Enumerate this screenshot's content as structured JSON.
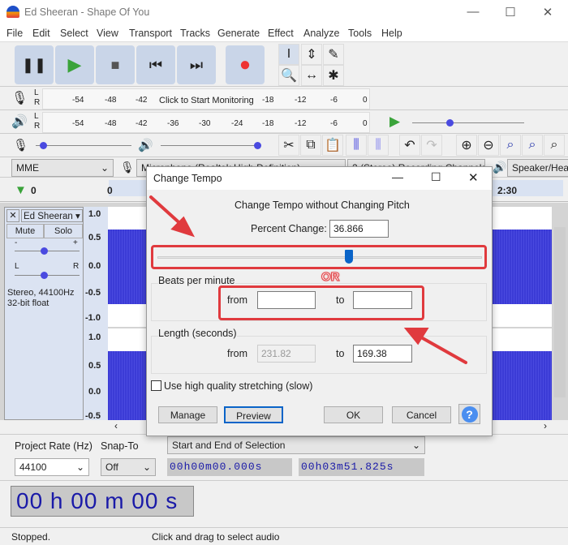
{
  "window": {
    "title": "Ed Sheeran - Shape Of You",
    "minimize": "—",
    "maximize": "☐",
    "close": "✕"
  },
  "menu": [
    "File",
    "Edit",
    "Select",
    "View",
    "Transport",
    "Tracks",
    "Generate",
    "Effect",
    "Analyze",
    "Tools",
    "Help"
  ],
  "transport": {
    "pause": "❚❚",
    "play": "▶",
    "stop": "■",
    "skip_start": "⏮",
    "skip_end": "⏭",
    "record": "●"
  },
  "tools": [
    "I",
    "⇕",
    "✎",
    "🔍",
    "↔",
    "✱"
  ],
  "record_meter": {
    "ticks": [
      "-54",
      "-48",
      "-42",
      "-18",
      "-12",
      "-6",
      "0"
    ],
    "prompt": "Click to Start Monitoring"
  },
  "play_meter": {
    "ticks": [
      "-54",
      "-48",
      "-42",
      "-36",
      "-30",
      "-24",
      "-18",
      "-12",
      "-6",
      "0"
    ]
  },
  "lr": [
    "L",
    "R"
  ],
  "slider_minus": "-",
  "slider_plus": "+",
  "devices": {
    "host": "MME",
    "mic": "Microphone (Realtek High Definition)",
    "channels": "2 (Stereo) Recording Channels",
    "speaker": "Speaker/Hea"
  },
  "timeline": {
    "labels": [
      "0",
      "0",
      "2:30"
    ]
  },
  "track": {
    "name": "Ed Sheeran",
    "close": "✕",
    "mute": "Mute",
    "solo": "Solo",
    "gain_minus": "-",
    "gain_plus": "+",
    "pan_l": "L",
    "pan_r": "R",
    "info1": "Stereo, 44100Hz",
    "info2": "32-bit float",
    "scale": [
      "1.0",
      "0.5",
      "0.0",
      "-0.5",
      "-1.0"
    ],
    "scale2": [
      "1.0",
      "0.5",
      "0.0",
      "-0.5"
    ]
  },
  "dialog": {
    "title": "Change Tempo",
    "heading": "Change Tempo without Changing Pitch",
    "percent_label": "Percent Change:",
    "percent_value": "36.866",
    "slider_fraction": 0.59,
    "or_label": "OR",
    "bpm_label": "Beats per minute",
    "from": "from",
    "to": "to",
    "bpm_from": "",
    "bpm_to": "",
    "length_label": "Length (seconds)",
    "length_from": "231.82",
    "length_to": "169.38",
    "hq_label": "Use high quality stretching (slow)",
    "hq_checked": false,
    "manage": "Manage",
    "preview": "Preview",
    "ok": "OK",
    "cancel": "Cancel",
    "help": "?"
  },
  "selection": {
    "rate_label": "Project Rate (Hz)",
    "snap_label": "Snap-To",
    "rate": "44100",
    "snap": "Off",
    "mode": "Start and End of Selection",
    "start": "00h00m00.000s",
    "end": "00h03m51.825s"
  },
  "time": {
    "display": "00 h 00 m 00 s"
  },
  "status": {
    "left": "Stopped.",
    "middle": "Click and drag to select audio"
  },
  "colors": {
    "waveform": "#3b3bd6",
    "annotation": "#e03a3e",
    "accent": "#0a64c8"
  }
}
